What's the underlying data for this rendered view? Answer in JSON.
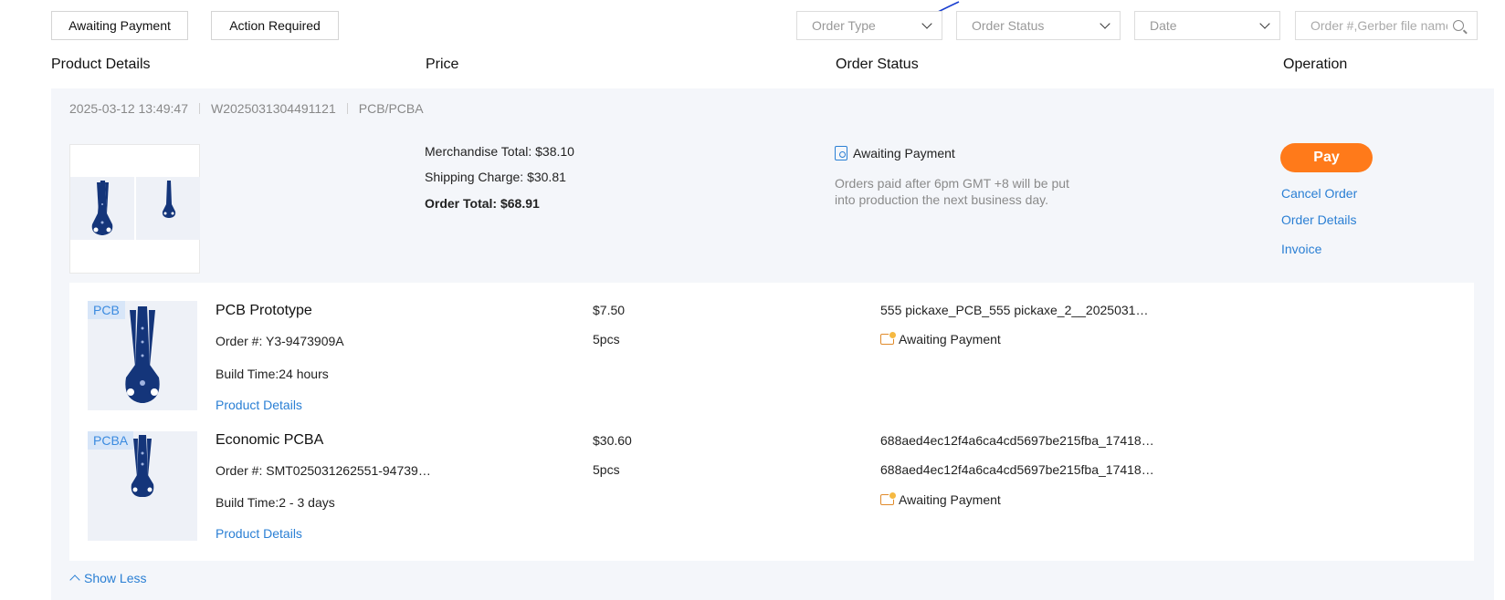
{
  "filters": {
    "chips": [
      "Awaiting Payment",
      "Action Required"
    ],
    "order_type": "Order Type",
    "order_status": "Order Status",
    "date": "Date",
    "search_placeholder": "Order #,Gerber file name"
  },
  "columns": {
    "product": "Product Details",
    "price": "Price",
    "status": "Order Status",
    "operation": "Operation"
  },
  "order": {
    "datetime": "2025-03-12 13:49:47",
    "number": "W2025031304491121",
    "category": "PCB/PCBA",
    "merchandise_total": "Merchandise Total: $38.10",
    "shipping_charge": "Shipping Charge: $30.81",
    "order_total": "Order Total: $68.91",
    "status": "Awaiting Payment",
    "status_note": "Orders paid after 6pm GMT +8 will be put into production the next business day.",
    "operations": {
      "pay": "Pay",
      "cancel": "Cancel Order",
      "details": "Order Details",
      "invoice": "Invoice"
    }
  },
  "items": [
    {
      "tag": "PCB",
      "name": "PCB Prototype",
      "order_no": "Order #: Y3-9473909A",
      "build_time": "Build Time:24 hours",
      "link": "Product Details",
      "price": "$7.50",
      "qty": "5pcs",
      "file": "555 pickaxe_PCB_555 pickaxe_2__2025031…",
      "status": "Awaiting Payment"
    },
    {
      "tag": "PCBA",
      "name": "Economic PCBA",
      "order_no": "Order #: SMT025031262551-94739…",
      "build_time": "Build Time:2 - 3 days",
      "link": "Product Details",
      "price": "$30.60",
      "qty": "5pcs",
      "file": "688aed4ec12f4a6ca4cd5697be215fba_17418…",
      "file2": "688aed4ec12f4a6ca4cd5697be215fba_17418…",
      "status": "Awaiting Payment"
    }
  ],
  "show_less": "Show Less",
  "colors": {
    "accent": "#2a7fd4",
    "pay_button": "#ff7a1a",
    "pcb_blue": "#14357a"
  },
  "icons": [
    "chevron-down-icon",
    "search-icon",
    "document-search-icon",
    "package-icon",
    "chevron-up-icon"
  ]
}
